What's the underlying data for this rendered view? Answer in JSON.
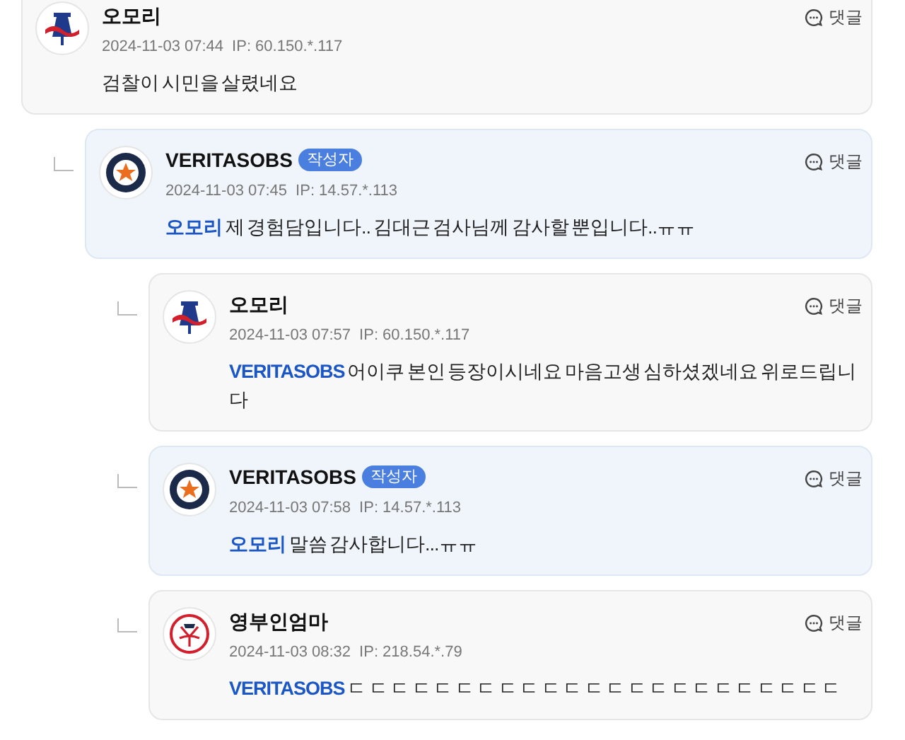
{
  "comments": [
    {
      "author": "오모리",
      "kind": "bell",
      "time": "2024-11-03 07:44",
      "ip": "IP: 60.150.*.117",
      "text": "검찰이 시민을 살렸네요",
      "reply_label": "댓글",
      "highlighted": false,
      "children": [
        {
          "author": "VERITASOBS",
          "badge": "작성자",
          "kind": "star",
          "time": "2024-11-03 07:45",
          "ip": "IP: 14.57.*.113",
          "mention": "오모리",
          "text": "제 경험담입니다.. 김대근 검사님께 감사할 뿐입니다..ㅠㅠ",
          "reply_label": "댓글",
          "highlighted": true,
          "children": [
            {
              "author": "오모리",
              "kind": "bell",
              "time": "2024-11-03 07:57",
              "ip": "IP: 60.150.*.117",
              "mention": "VERITASOBS",
              "text": "어이쿠 본인 등장이시네요 마음고생 심하셨겠네요 위로드립니다",
              "reply_label": "댓글",
              "highlighted": false
            },
            {
              "author": "VERITASOBS",
              "badge": "작성자",
              "kind": "star",
              "time": "2024-11-03 07:58",
              "ip": "IP: 14.57.*.113",
              "mention": "오모리",
              "text": "말씀 감사합니다...ㅠㅠ",
              "reply_label": "댓글",
              "highlighted": true
            },
            {
              "author": "영부인엄마",
              "kind": "ring",
              "time": "2024-11-03 08:32",
              "ip": "IP: 218.54.*.79",
              "mention": "VERITASOBS",
              "text": "ㄷ ㄷ ㄷ ㄷ ㄷ ㄷ ㄷ ㄷ ㄷ ㄷ ㄷ ㄷ ㄷ ㄷ ㄷ ㄷ ㄷ ㄷ ㄷ ㄷ ㄷ ㄷ ㄷ",
              "reply_label": "댓글",
              "highlighted": false
            }
          ]
        }
      ]
    }
  ]
}
